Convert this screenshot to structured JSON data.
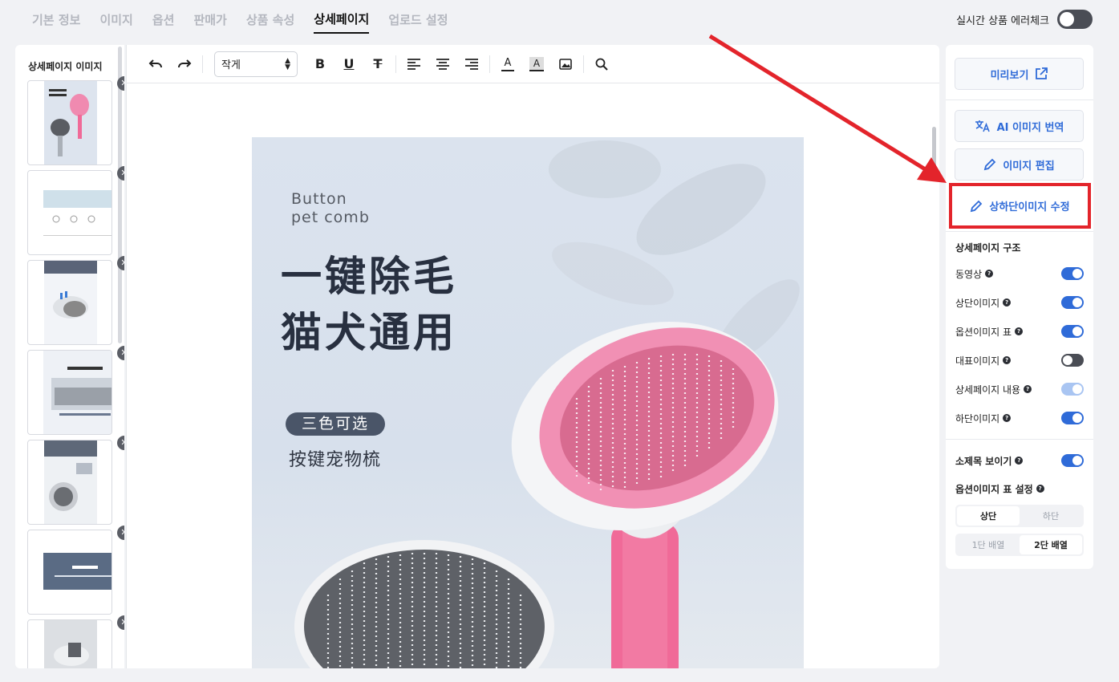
{
  "tabs": [
    {
      "label": "기본 정보",
      "active": false
    },
    {
      "label": "이미지",
      "active": false
    },
    {
      "label": "옵션",
      "active": false
    },
    {
      "label": "판매가",
      "active": false
    },
    {
      "label": "상품 속성",
      "active": false
    },
    {
      "label": "상세페이지",
      "active": true
    },
    {
      "label": "업로드 설정",
      "active": false
    }
  ],
  "realtime_check": {
    "label": "실시간 상품 에러체크",
    "on": false
  },
  "left_panel": {
    "title": "상세페이지 이미지",
    "close_glyph": "✕"
  },
  "toolbar": {
    "font_size": "작게",
    "icons": [
      "undo-icon",
      "redo-icon",
      "bold-icon",
      "underline-icon",
      "strikethrough-icon",
      "align-left-icon",
      "align-center-icon",
      "align-right-icon",
      "text-color-icon",
      "text-background-icon",
      "image-icon",
      "search-icon"
    ],
    "bold": "B",
    "underline": "U",
    "strike": "T",
    "text_color": "A",
    "text_bg": "A"
  },
  "product_image": {
    "en_line1": "Button",
    "en_line2": "pet comb",
    "headline1": "一键除毛",
    "headline2": "猫犬通用",
    "pill": "三色可选",
    "sub": "按键宠物梳"
  },
  "right_panel": {
    "preview": "미리보기",
    "ai_translate": "AI 이미지 번역",
    "edit_image": "이미지 편집",
    "top_bottom_edit": "상하단이미지 수정",
    "structure_title": "상세페이지 구조",
    "structure": [
      {
        "label": "동영상",
        "state": "on"
      },
      {
        "label": "상단이미지",
        "state": "on"
      },
      {
        "label": "옵션이미지 표",
        "state": "on"
      },
      {
        "label": "대표이미지",
        "state": "off"
      },
      {
        "label": "상세페이지 내용",
        "state": "dim"
      },
      {
        "label": "하단이미지",
        "state": "on"
      }
    ],
    "subtitle_label": "소제목 보이기",
    "subtitle_on": true,
    "option_table_title": "옵션이미지 표 설정",
    "position": {
      "options": [
        "상단",
        "하단"
      ],
      "selected": "상단"
    },
    "layout": {
      "options": [
        "1단 배열",
        "2단 배열"
      ],
      "selected": "2단 배열"
    },
    "q": "?"
  },
  "colors": {
    "accent": "#2f6bd8",
    "highlight": "#e3242b",
    "pink": "#f07ba0"
  }
}
